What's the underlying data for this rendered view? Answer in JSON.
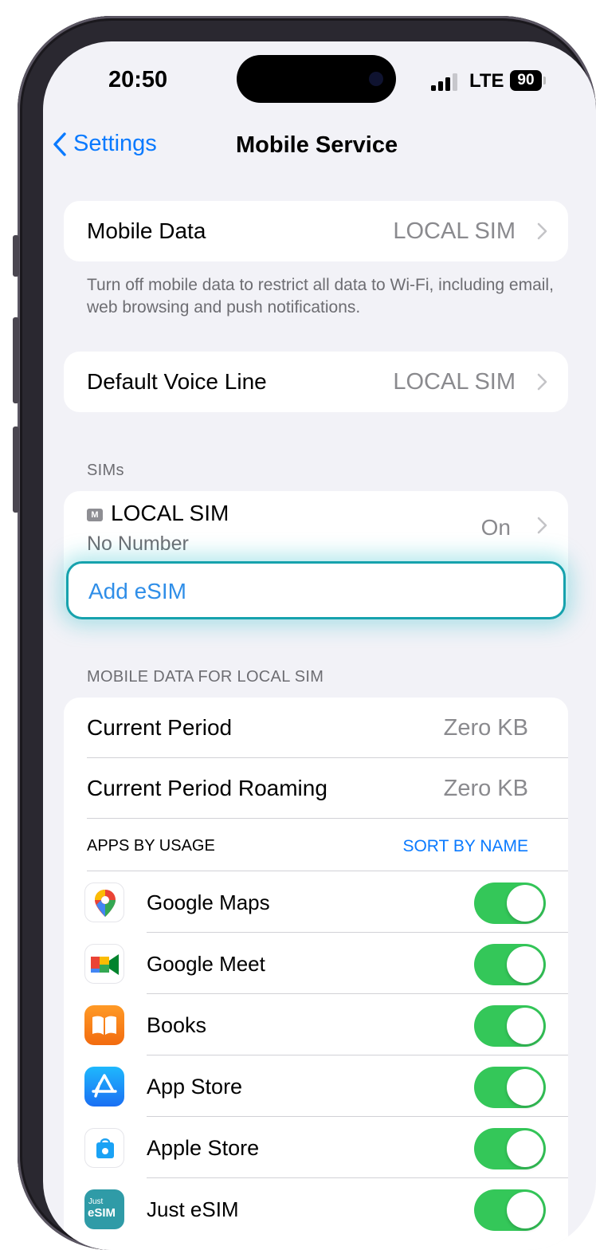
{
  "status": {
    "time": "20:50",
    "network": "LTE",
    "battery": "90"
  },
  "nav": {
    "back_label": "Settings",
    "title": "Mobile Service"
  },
  "mobile_data": {
    "label": "Mobile Data",
    "value": "LOCAL SIM"
  },
  "mobile_data_footer": "Turn off mobile data to restrict all data to Wi-Fi, including email, web browsing and push notifications.",
  "voice": {
    "label": "Default Voice Line",
    "value": "LOCAL SIM"
  },
  "sims": {
    "header": "SIMs",
    "local": {
      "tag": "M",
      "name": "LOCAL SIM",
      "number": "No Number",
      "status": "On"
    },
    "add_esim": "Add eSIM"
  },
  "usage": {
    "header": "MOBILE DATA FOR LOCAL SIM",
    "current_period": {
      "label": "Current Period",
      "value": "Zero KB"
    },
    "roaming": {
      "label": "Current Period Roaming",
      "value": "Zero KB"
    },
    "apps_header": "APPS BY USAGE",
    "sort_label": "SORT BY NAME",
    "apps": [
      {
        "name": "Google Maps",
        "icon": "google-maps-icon",
        "enabled": true
      },
      {
        "name": "Google Meet",
        "icon": "google-meet-icon",
        "enabled": true
      },
      {
        "name": "Books",
        "icon": "books-icon",
        "enabled": true
      },
      {
        "name": "App Store",
        "icon": "app-store-icon",
        "enabled": true
      },
      {
        "name": "Apple Store",
        "icon": "apple-store-icon",
        "enabled": true
      },
      {
        "name": "Just eSIM",
        "icon": "just-esim-icon",
        "enabled": true,
        "icon_text_top": "Just",
        "icon_text_bottom": "eSIM"
      }
    ]
  },
  "colors": {
    "accent": "#0a7aff",
    "toggle_on": "#34c759",
    "highlight": "#16a2ad",
    "background": "#f2f2f7"
  }
}
